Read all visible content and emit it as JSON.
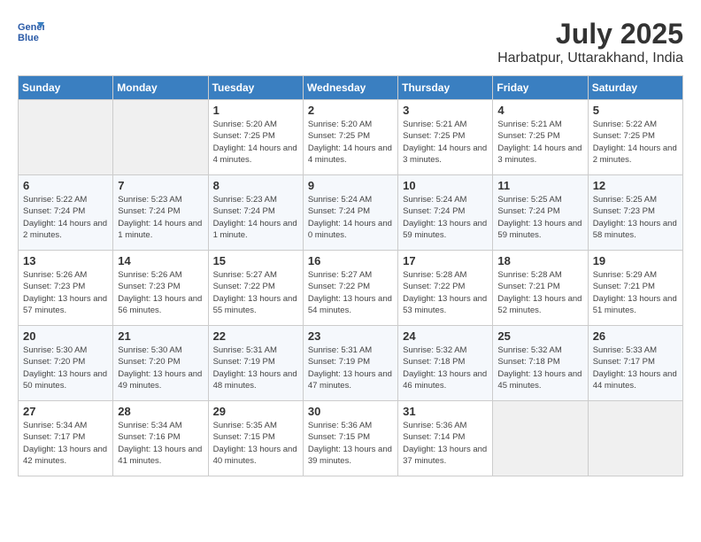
{
  "header": {
    "logo_line1": "General",
    "logo_line2": "Blue",
    "month": "July 2025",
    "location": "Harbatpur, Uttarakhand, India"
  },
  "weekdays": [
    "Sunday",
    "Monday",
    "Tuesday",
    "Wednesday",
    "Thursday",
    "Friday",
    "Saturday"
  ],
  "weeks": [
    [
      {
        "day": "",
        "sunrise": "",
        "sunset": "",
        "daylight": ""
      },
      {
        "day": "",
        "sunrise": "",
        "sunset": "",
        "daylight": ""
      },
      {
        "day": "1",
        "sunrise": "Sunrise: 5:20 AM",
        "sunset": "Sunset: 7:25 PM",
        "daylight": "Daylight: 14 hours and 4 minutes."
      },
      {
        "day": "2",
        "sunrise": "Sunrise: 5:20 AM",
        "sunset": "Sunset: 7:25 PM",
        "daylight": "Daylight: 14 hours and 4 minutes."
      },
      {
        "day": "3",
        "sunrise": "Sunrise: 5:21 AM",
        "sunset": "Sunset: 7:25 PM",
        "daylight": "Daylight: 14 hours and 3 minutes."
      },
      {
        "day": "4",
        "sunrise": "Sunrise: 5:21 AM",
        "sunset": "Sunset: 7:25 PM",
        "daylight": "Daylight: 14 hours and 3 minutes."
      },
      {
        "day": "5",
        "sunrise": "Sunrise: 5:22 AM",
        "sunset": "Sunset: 7:25 PM",
        "daylight": "Daylight: 14 hours and 2 minutes."
      }
    ],
    [
      {
        "day": "6",
        "sunrise": "Sunrise: 5:22 AM",
        "sunset": "Sunset: 7:24 PM",
        "daylight": "Daylight: 14 hours and 2 minutes."
      },
      {
        "day": "7",
        "sunrise": "Sunrise: 5:23 AM",
        "sunset": "Sunset: 7:24 PM",
        "daylight": "Daylight: 14 hours and 1 minute."
      },
      {
        "day": "8",
        "sunrise": "Sunrise: 5:23 AM",
        "sunset": "Sunset: 7:24 PM",
        "daylight": "Daylight: 14 hours and 1 minute."
      },
      {
        "day": "9",
        "sunrise": "Sunrise: 5:24 AM",
        "sunset": "Sunset: 7:24 PM",
        "daylight": "Daylight: 14 hours and 0 minutes."
      },
      {
        "day": "10",
        "sunrise": "Sunrise: 5:24 AM",
        "sunset": "Sunset: 7:24 PM",
        "daylight": "Daylight: 13 hours and 59 minutes."
      },
      {
        "day": "11",
        "sunrise": "Sunrise: 5:25 AM",
        "sunset": "Sunset: 7:24 PM",
        "daylight": "Daylight: 13 hours and 59 minutes."
      },
      {
        "day": "12",
        "sunrise": "Sunrise: 5:25 AM",
        "sunset": "Sunset: 7:23 PM",
        "daylight": "Daylight: 13 hours and 58 minutes."
      }
    ],
    [
      {
        "day": "13",
        "sunrise": "Sunrise: 5:26 AM",
        "sunset": "Sunset: 7:23 PM",
        "daylight": "Daylight: 13 hours and 57 minutes."
      },
      {
        "day": "14",
        "sunrise": "Sunrise: 5:26 AM",
        "sunset": "Sunset: 7:23 PM",
        "daylight": "Daylight: 13 hours and 56 minutes."
      },
      {
        "day": "15",
        "sunrise": "Sunrise: 5:27 AM",
        "sunset": "Sunset: 7:22 PM",
        "daylight": "Daylight: 13 hours and 55 minutes."
      },
      {
        "day": "16",
        "sunrise": "Sunrise: 5:27 AM",
        "sunset": "Sunset: 7:22 PM",
        "daylight": "Daylight: 13 hours and 54 minutes."
      },
      {
        "day": "17",
        "sunrise": "Sunrise: 5:28 AM",
        "sunset": "Sunset: 7:22 PM",
        "daylight": "Daylight: 13 hours and 53 minutes."
      },
      {
        "day": "18",
        "sunrise": "Sunrise: 5:28 AM",
        "sunset": "Sunset: 7:21 PM",
        "daylight": "Daylight: 13 hours and 52 minutes."
      },
      {
        "day": "19",
        "sunrise": "Sunrise: 5:29 AM",
        "sunset": "Sunset: 7:21 PM",
        "daylight": "Daylight: 13 hours and 51 minutes."
      }
    ],
    [
      {
        "day": "20",
        "sunrise": "Sunrise: 5:30 AM",
        "sunset": "Sunset: 7:20 PM",
        "daylight": "Daylight: 13 hours and 50 minutes."
      },
      {
        "day": "21",
        "sunrise": "Sunrise: 5:30 AM",
        "sunset": "Sunset: 7:20 PM",
        "daylight": "Daylight: 13 hours and 49 minutes."
      },
      {
        "day": "22",
        "sunrise": "Sunrise: 5:31 AM",
        "sunset": "Sunset: 7:19 PM",
        "daylight": "Daylight: 13 hours and 48 minutes."
      },
      {
        "day": "23",
        "sunrise": "Sunrise: 5:31 AM",
        "sunset": "Sunset: 7:19 PM",
        "daylight": "Daylight: 13 hours and 47 minutes."
      },
      {
        "day": "24",
        "sunrise": "Sunrise: 5:32 AM",
        "sunset": "Sunset: 7:18 PM",
        "daylight": "Daylight: 13 hours and 46 minutes."
      },
      {
        "day": "25",
        "sunrise": "Sunrise: 5:32 AM",
        "sunset": "Sunset: 7:18 PM",
        "daylight": "Daylight: 13 hours and 45 minutes."
      },
      {
        "day": "26",
        "sunrise": "Sunrise: 5:33 AM",
        "sunset": "Sunset: 7:17 PM",
        "daylight": "Daylight: 13 hours and 44 minutes."
      }
    ],
    [
      {
        "day": "27",
        "sunrise": "Sunrise: 5:34 AM",
        "sunset": "Sunset: 7:17 PM",
        "daylight": "Daylight: 13 hours and 42 minutes."
      },
      {
        "day": "28",
        "sunrise": "Sunrise: 5:34 AM",
        "sunset": "Sunset: 7:16 PM",
        "daylight": "Daylight: 13 hours and 41 minutes."
      },
      {
        "day": "29",
        "sunrise": "Sunrise: 5:35 AM",
        "sunset": "Sunset: 7:15 PM",
        "daylight": "Daylight: 13 hours and 40 minutes."
      },
      {
        "day": "30",
        "sunrise": "Sunrise: 5:36 AM",
        "sunset": "Sunset: 7:15 PM",
        "daylight": "Daylight: 13 hours and 39 minutes."
      },
      {
        "day": "31",
        "sunrise": "Sunrise: 5:36 AM",
        "sunset": "Sunset: 7:14 PM",
        "daylight": "Daylight: 13 hours and 37 minutes."
      },
      {
        "day": "",
        "sunrise": "",
        "sunset": "",
        "daylight": ""
      },
      {
        "day": "",
        "sunrise": "",
        "sunset": "",
        "daylight": ""
      }
    ]
  ]
}
